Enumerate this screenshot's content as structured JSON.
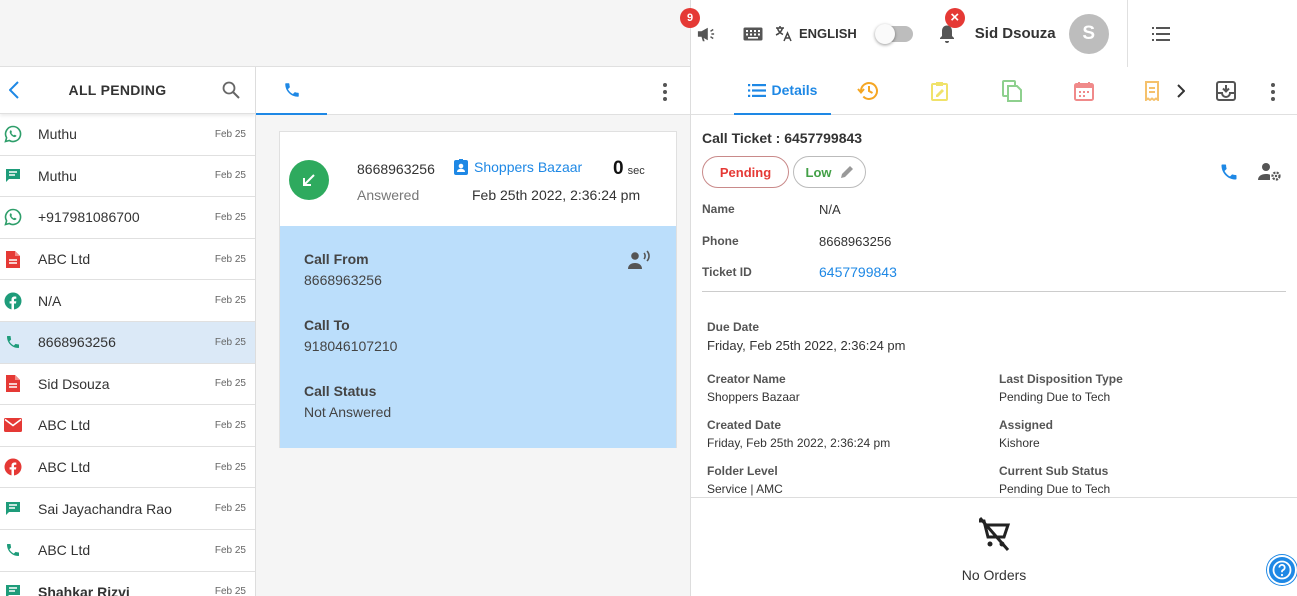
{
  "topbar": {
    "announcements_count": "9",
    "language": "ENGLISH",
    "notifications_badge": "×",
    "user_name": "Sid Dsouza",
    "avatar_initial": "S"
  },
  "left": {
    "title": "ALL PENDING",
    "items": [
      {
        "name": "Muthu",
        "date": "Feb 25",
        "channel": "whatsapp-icon"
      },
      {
        "name": "Muthu",
        "date": "Feb 25",
        "channel": "chat-icon"
      },
      {
        "name": "+917981086700",
        "date": "Feb 25",
        "channel": "whatsapp-icon"
      },
      {
        "name": "ABC Ltd",
        "date": "Feb 25",
        "channel": "document-icon"
      },
      {
        "name": "N/A",
        "date": "Feb 25",
        "channel": "facebook-icon"
      },
      {
        "name": "8668963256",
        "date": "Feb 25",
        "channel": "phone-icon"
      },
      {
        "name": "Sid Dsouza",
        "date": "Feb 25",
        "channel": "document-icon"
      },
      {
        "name": "ABC Ltd",
        "date": "Feb 25",
        "channel": "email-icon"
      },
      {
        "name": "ABC Ltd",
        "date": "Feb 25",
        "channel": "facebook-icon"
      },
      {
        "name": "Sai Jayachandra Rao",
        "date": "Feb 25",
        "channel": "chat-icon"
      },
      {
        "name": "ABC Ltd",
        "date": "Feb 25",
        "channel": "phone-icon"
      },
      {
        "name": "Shahkar Rizvi",
        "date": "Feb 25",
        "channel": "chat-icon"
      }
    ]
  },
  "call": {
    "phone": "8668963256",
    "state": "Answered",
    "company": "Shoppers Bazaar",
    "duration_value": "0",
    "duration_unit": "sec",
    "datetime": "Feb 25th 2022, 2:36:24 pm",
    "call_from_label": "Call From",
    "call_from": "8668963256",
    "call_to_label": "Call To",
    "call_to": "918046107210",
    "call_status_label": "Call Status",
    "call_status": "Not Answered"
  },
  "ticket": {
    "tab_details": "Details",
    "title": "Call Ticket : 6457799843",
    "status": "Pending",
    "priority": "Low",
    "name_label": "Name",
    "name": "N/A",
    "phone_label": "Phone",
    "phone": "8668963256",
    "id_label": "Ticket ID",
    "id": "6457799843",
    "due_label": "Due Date",
    "due": "Friday, Feb 25th 2022, 2:36:24 pm",
    "creator_label": "Creator Name",
    "creator": "Shoppers Bazaar",
    "last_disp_label": "Last Disposition Type",
    "last_disp": "Pending Due to Tech",
    "created_label": "Created Date",
    "created": "Friday, Feb 25th 2022, 2:36:24 pm",
    "assigned_label": "Assigned",
    "assigned": "Kishore",
    "folder_label": "Folder Level",
    "folder": "Service | AMC",
    "sub_status_label": "Current Sub Status",
    "sub_status": "Pending Due to Tech",
    "no_orders": "No Orders"
  },
  "colors": {
    "accent": "#1e88e5",
    "pending": "#e53935",
    "low": "#43a047",
    "call_panel": "#bbdefb",
    "selected_row": "#dbe9f7"
  }
}
